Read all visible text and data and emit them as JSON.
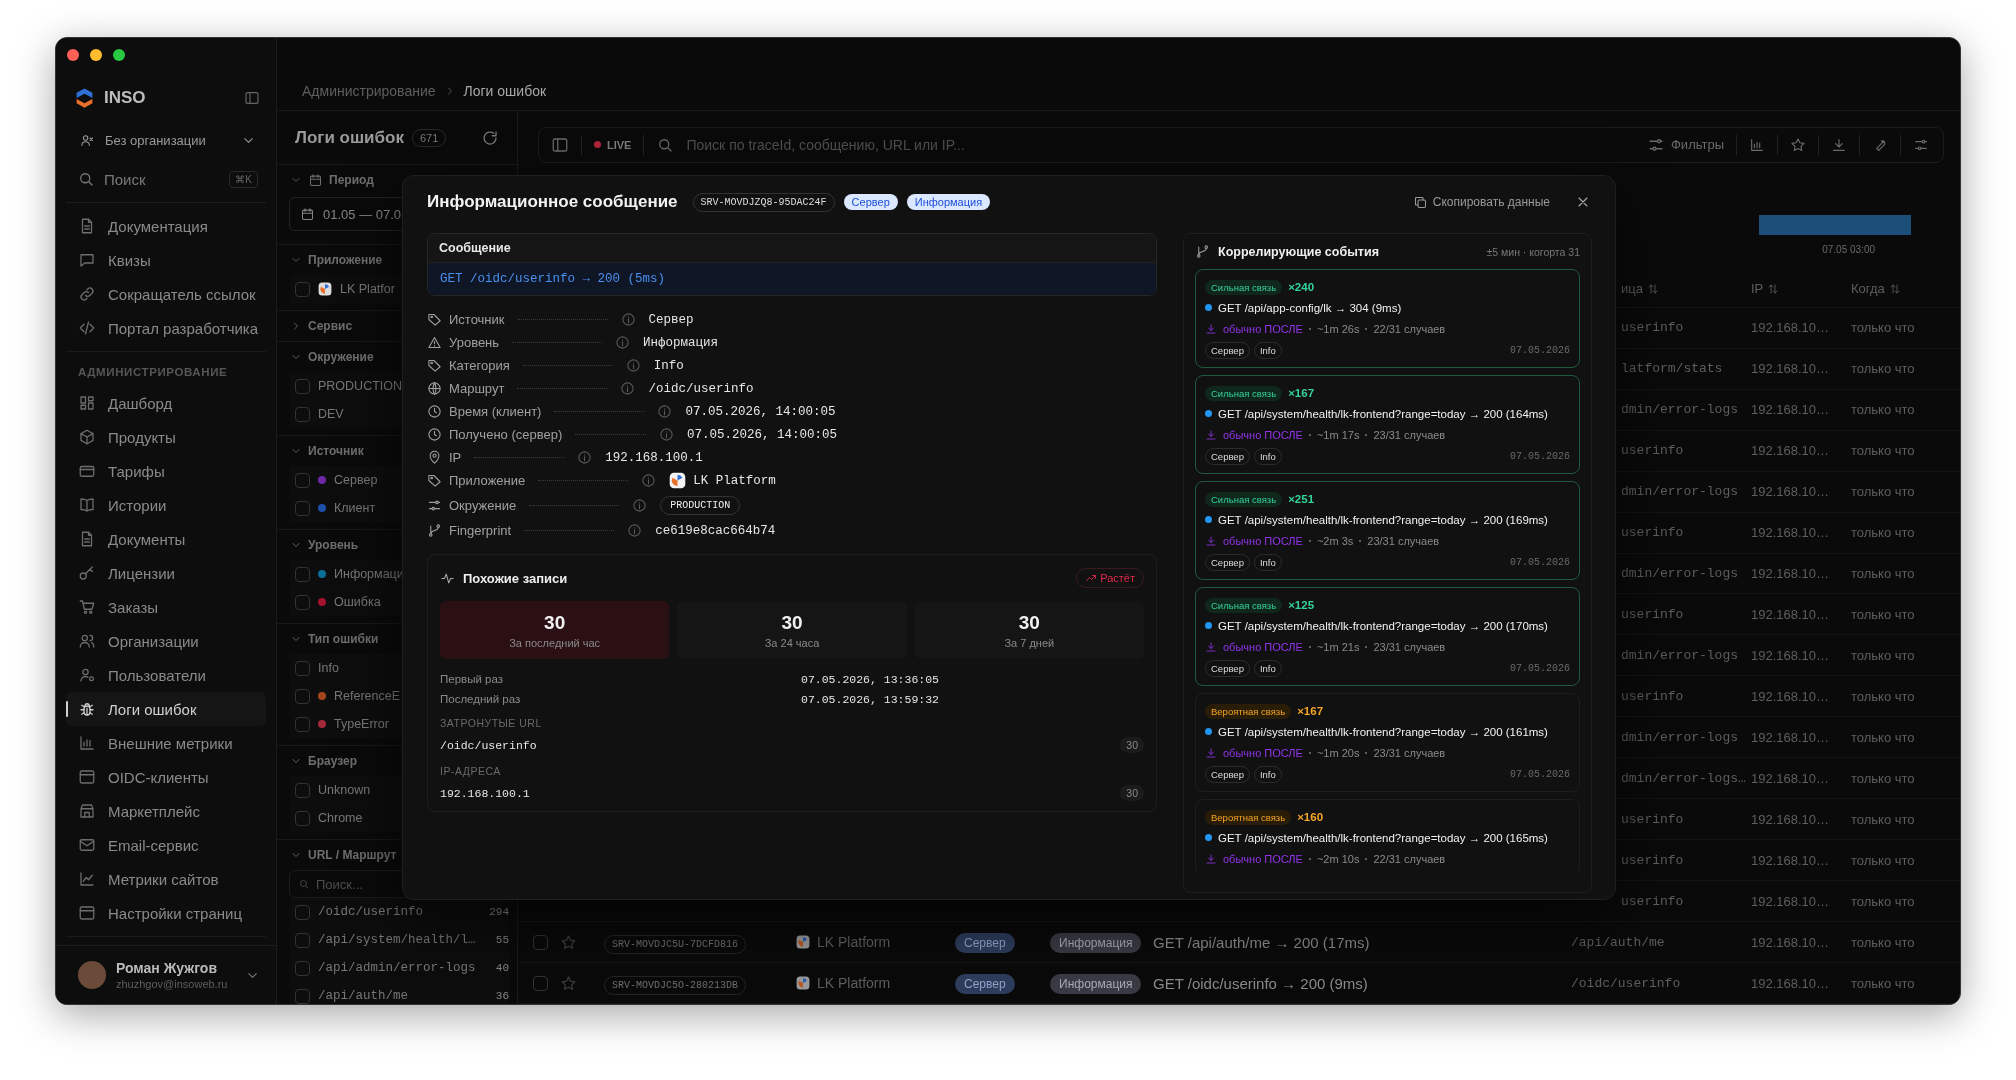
{
  "window": {
    "app_name": "INSO"
  },
  "sidebar": {
    "organization": "Без организации",
    "search": {
      "placeholder": "Поиск",
      "shortcut": "⌘K"
    },
    "items": [
      {
        "label": "Документация",
        "selected": false
      },
      {
        "label": "Квизы",
        "selected": false
      },
      {
        "label": "Сокращатель ссылок",
        "selected": false
      },
      {
        "label": "Портал разработчика",
        "selected": false
      }
    ],
    "section_title": "АДМИНИСТРИРОВАНИЕ",
    "admin_items": [
      {
        "label": "Дашборд",
        "selected": false
      },
      {
        "label": "Продукты",
        "selected": false
      },
      {
        "label": "Тарифы",
        "selected": false
      },
      {
        "label": "Истории",
        "selected": false
      },
      {
        "label": "Документы",
        "selected": false
      },
      {
        "label": "Лицензии",
        "selected": false
      },
      {
        "label": "Заказы",
        "selected": false
      },
      {
        "label": "Организации",
        "selected": false
      },
      {
        "label": "Пользователи",
        "selected": false
      },
      {
        "label": "Логи ошибок",
        "selected": true
      },
      {
        "label": "Внешние метрики",
        "selected": false
      },
      {
        "label": "OIDC-клиенты",
        "selected": false
      },
      {
        "label": "Маркетплейс",
        "selected": false
      },
      {
        "label": "Email-сервис",
        "selected": false
      },
      {
        "label": "Метрики сайтов",
        "selected": false
      },
      {
        "label": "Настройки страниц",
        "selected": false
      }
    ],
    "user": {
      "name": "Роман Жужгов",
      "email": "zhuzhgov@insoweb.ru"
    }
  },
  "breadcrumb": [
    "Администрирование",
    "Логи ошибок"
  ],
  "filters": {
    "title": "Логи ошибок",
    "count": "671",
    "sections": [
      {
        "title": "Период",
        "expanded": true,
        "date_value": "01.05 — 07.0"
      },
      {
        "title": "Приложение",
        "expanded": true,
        "items": [
          {
            "label": "LK Platfor",
            "kind": "app",
            "checked": false
          }
        ]
      },
      {
        "title": "Сервис",
        "expanded": false
      },
      {
        "title": "Окружение",
        "expanded": true,
        "items": [
          {
            "label": "PRODUCTION",
            "kind": "plain",
            "checked": false
          },
          {
            "label": "DEV",
            "kind": "plain",
            "checked": false
          }
        ]
      },
      {
        "title": "Источник",
        "expanded": true,
        "items": [
          {
            "label": "Сервер",
            "kind": "dot",
            "color": "#6d28a8",
            "checked": false
          },
          {
            "label": "Клиент",
            "kind": "dot",
            "color": "#1e4fa8",
            "checked": false
          }
        ]
      },
      {
        "title": "Уровень",
        "expanded": true,
        "items": [
          {
            "label": "Информаци",
            "kind": "dot",
            "color": "#0b6e98",
            "checked": false
          },
          {
            "label": "Ошибка",
            "kind": "dot",
            "color": "#a3122f",
            "checked": false
          }
        ]
      },
      {
        "title": "Тип ошибки",
        "expanded": true,
        "items": [
          {
            "label": "Info",
            "kind": "plain",
            "checked": false
          },
          {
            "label": "ReferenceE",
            "kind": "dot",
            "color": "#a4461a",
            "checked": false
          },
          {
            "label": "TypeError",
            "kind": "dot",
            "color": "#a3283a",
            "checked": false
          }
        ]
      },
      {
        "title": "Браузер",
        "expanded": true,
        "items": [
          {
            "label": "Unknown",
            "kind": "plain",
            "checked": false
          },
          {
            "label": "Chrome",
            "kind": "plain",
            "checked": false
          }
        ]
      },
      {
        "title": "URL / Маршрут",
        "expanded": true,
        "search_placeholder": "Поиск...",
        "items": [
          {
            "label": "/oidc/userinfo",
            "kind": "url",
            "count": "294",
            "checked": false
          },
          {
            "label": "/api/system/health/l…",
            "kind": "url",
            "count": "55",
            "checked": false
          },
          {
            "label": "/api/admin/error-logs",
            "kind": "url",
            "count": "40",
            "checked": false
          },
          {
            "label": "/api/auth/me",
            "kind": "url",
            "count": "36",
            "checked": false
          }
        ]
      }
    ]
  },
  "toolbar": {
    "live": "LIVE",
    "search_placeholder": "Поиск по traceId, сообщению, URL или IP...",
    "filters_label": "Фильтры"
  },
  "timeline": {
    "tick": "07.05 03:00"
  },
  "table": {
    "columns": [
      "ица",
      "IP",
      "Когда"
    ],
    "rows": [
      {
        "kind": "covered",
        "url": "userinfo",
        "ip": "192.168.10…",
        "when": "только что"
      },
      {
        "kind": "covered",
        "url": "latform/stats",
        "ip": "192.168.10…",
        "when": "только что"
      },
      {
        "kind": "covered",
        "url": "dmin/error-logs",
        "ip": "192.168.10…",
        "when": "только что"
      },
      {
        "kind": "covered",
        "url": "userinfo",
        "ip": "192.168.10…",
        "when": "только что"
      },
      {
        "kind": "covered",
        "url": "dmin/error-logs",
        "ip": "192.168.10…",
        "when": "только что"
      },
      {
        "kind": "covered",
        "url": "userinfo",
        "ip": "192.168.10…",
        "when": "только что"
      },
      {
        "kind": "covered",
        "url": "dmin/error-logs",
        "ip": "192.168.10…",
        "when": "только что"
      },
      {
        "kind": "covered",
        "url": "userinfo",
        "ip": "192.168.10…",
        "when": "только что"
      },
      {
        "kind": "covered",
        "url": "dmin/error-logs",
        "ip": "192.168.10…",
        "when": "только что"
      },
      {
        "kind": "covered",
        "url": "userinfo",
        "ip": "192.168.10…",
        "when": "только что"
      },
      {
        "kind": "covered",
        "url": "dmin/error-logs",
        "ip": "192.168.10…",
        "when": "только что"
      },
      {
        "kind": "covered",
        "url": "dmin/error-logs…",
        "ip": "192.168.10…",
        "when": "только что"
      },
      {
        "kind": "covered",
        "url": "userinfo",
        "ip": "192.168.10…",
        "when": "только что"
      },
      {
        "kind": "covered",
        "url": "userinfo",
        "ip": "192.168.10…",
        "when": "только что"
      },
      {
        "kind": "covered",
        "url": "userinfo",
        "ip": "192.168.10…",
        "when": "только что"
      },
      {
        "kind": "full",
        "checked": false,
        "starred": false,
        "id": "SRV-MOVDJC5U-7DCFD816",
        "app": "LK Platform",
        "source": "Сервер",
        "level": "Информация",
        "message": "GET /api/auth/me → 200 (17ms)",
        "url": "/api/auth/me",
        "ip": "192.168.10…",
        "when": "только что"
      },
      {
        "kind": "full",
        "checked": false,
        "starred": false,
        "id": "SRV-MOVDJC5O-280213DB",
        "app": "LK Platform",
        "source": "Сервер",
        "level": "Информация",
        "message": "GET /oidc/userinfo → 200 (9ms)",
        "url": "/oidc/userinfo",
        "ip": "192.168.10…",
        "when": "только что"
      }
    ]
  },
  "dialog": {
    "title": "Информационное сообщение",
    "id": "SRV-MOVDJZQ8-95DAC24F",
    "badges": [
      "Сервер",
      "Информация"
    ],
    "copy_label": "Скопировать данные",
    "message": {
      "heading": "Сообщение",
      "text": "GET /oidc/userinfo → 200 (5ms)"
    },
    "fields": [
      {
        "label": "Источник",
        "value": "Сервер",
        "kind": "text"
      },
      {
        "label": "Уровень",
        "value": "Информация",
        "kind": "text"
      },
      {
        "label": "Категория",
        "value": "Info",
        "kind": "text"
      },
      {
        "label": "Маршрут",
        "value": "/oidc/userinfo",
        "kind": "text"
      },
      {
        "label": "Время (клиент)",
        "value": "07.05.2026, 14:00:05",
        "kind": "text"
      },
      {
        "label": "Получено (сервер)",
        "value": "07.05.2026, 14:00:05",
        "kind": "text"
      },
      {
        "label": "IP",
        "value": "192.168.100.1",
        "kind": "text"
      },
      {
        "label": "Приложение",
        "value": "LK Platform",
        "kind": "app"
      },
      {
        "label": "Окружение",
        "value": "PRODUCTION",
        "kind": "tag"
      },
      {
        "label": "Fingerprint",
        "value": "ce619e8cac664b74",
        "kind": "text"
      }
    ],
    "similar": {
      "title": "Похожие записи",
      "trend": "Растёт",
      "stats": [
        {
          "value": "30",
          "label": "За последний час",
          "highlighted": true
        },
        {
          "value": "30",
          "label": "За 24 часа",
          "highlighted": false
        },
        {
          "value": "30",
          "label": "За 7 дней",
          "highlighted": false
        }
      ],
      "first_seen": {
        "label": "Первый раз",
        "value": "07.05.2026, 13:36:05"
      },
      "last_seen": {
        "label": "Последний раз",
        "value": "07.05.2026, 13:59:32"
      },
      "urls": {
        "heading": "ЗАТРОНУТЫЕ URL",
        "items": [
          {
            "value": "/oidc/userinfo",
            "count": "30"
          }
        ]
      },
      "ips": {
        "heading": "IP-АДРЕСА",
        "items": [
          {
            "value": "192.168.100.1",
            "count": "30"
          }
        ]
      }
    },
    "correlated": {
      "title": "Коррелирующие события",
      "meta": "±5 мин · когорта 31",
      "events": [
        {
          "kind": "strong",
          "strength": "Сильная связь",
          "count": "×240",
          "message": "GET /api/app-config/lk → 304 (9ms)",
          "timing": "обычно ПОСЛЕ",
          "delay": "~1m 26s",
          "cases": "22/31 случаев",
          "tags": [
            "Сервер",
            "Info"
          ],
          "date": "07.05.2026"
        },
        {
          "kind": "strong",
          "strength": "Сильная связь",
          "count": "×167",
          "message": "GET /api/system/health/lk-frontend?range=today → 200 (164ms)",
          "timing": "обычно ПОСЛЕ",
          "delay": "~1m 17s",
          "cases": "23/31 случаев",
          "tags": [
            "Сервер",
            "Info"
          ],
          "date": "07.05.2026"
        },
        {
          "kind": "strong",
          "strength": "Сильная связь",
          "count": "×251",
          "message": "GET /api/system/health/lk-frontend?range=today → 200 (169ms)",
          "timing": "обычно ПОСЛЕ",
          "delay": "~2m 3s",
          "cases": "23/31 случаев",
          "tags": [
            "Сервер",
            "Info"
          ],
          "date": "07.05.2026"
        },
        {
          "kind": "strong",
          "strength": "Сильная связь",
          "count": "×125",
          "message": "GET /api/system/health/lk-frontend?range=today → 200 (170ms)",
          "timing": "обычно ПОСЛЕ",
          "delay": "~1m 21s",
          "cases": "23/31 случаев",
          "tags": [
            "Сервер",
            "Info"
          ],
          "date": "07.05.2026"
        },
        {
          "kind": "probable",
          "strength": "Вероятная связь",
          "count": "×167",
          "message": "GET /api/system/health/lk-frontend?range=today → 200 (161ms)",
          "timing": "обычно ПОСЛЕ",
          "delay": "~1m 20s",
          "cases": "23/31 случаев",
          "tags": [
            "Сервер",
            "Info"
          ],
          "date": "07.05.2026"
        },
        {
          "kind": "probable",
          "strength": "Вероятная связь",
          "count": "×160",
          "message": "GET /api/system/health/lk-frontend?range=today → 200 (165ms)",
          "timing": "обычно ПОСЛЕ",
          "delay": "~2m 10s",
          "cases": "22/31 случаев"
        }
      ]
    }
  }
}
